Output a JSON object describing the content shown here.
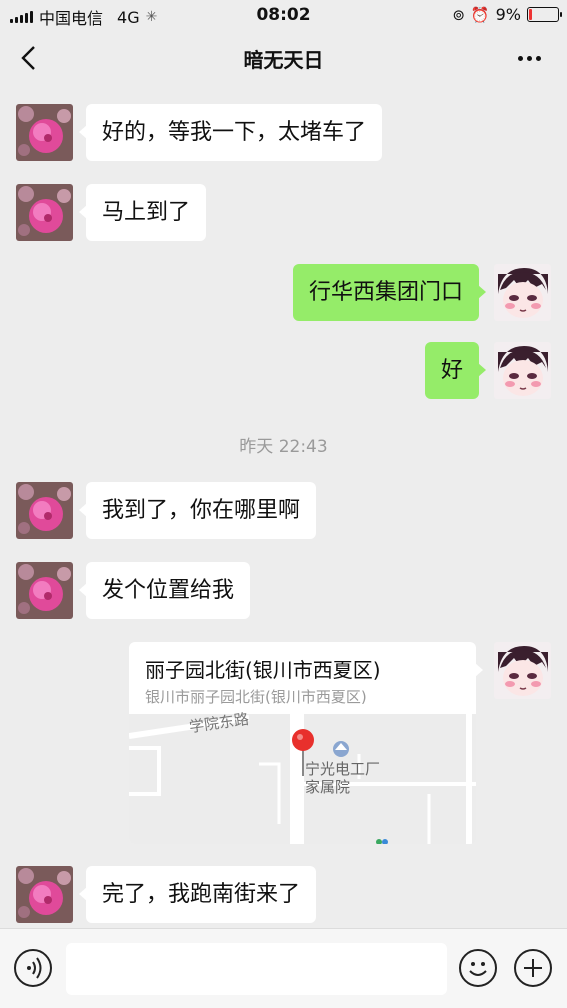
{
  "status_bar": {
    "carrier": "中国电信",
    "network": "4G",
    "time": "08:02",
    "battery_percent": "9%",
    "battery_level": 0.09
  },
  "header": {
    "title": "暗无天日"
  },
  "messages": [
    {
      "direction": "in",
      "text": "好的，等我一下，太堵车了"
    },
    {
      "direction": "in",
      "text": "马上到了"
    },
    {
      "direction": "out",
      "text": "行华西集团门口"
    },
    {
      "direction": "out",
      "text": "好"
    },
    {
      "direction": "in",
      "text": "我到了，你在哪里啊"
    },
    {
      "direction": "in",
      "text": "发个位置给我"
    },
    {
      "direction": "in",
      "text": "完了，我跑南街来了"
    }
  ],
  "timestamp": "昨天 22:43",
  "location": {
    "title": "丽子园北街(银川市西夏区)",
    "address": "银川市丽子园北街(银川市西夏区)",
    "map_label_road": "学院东路",
    "map_label_poi": "宁光电工厂\n家属院"
  },
  "input": {
    "placeholder": ""
  },
  "colors": {
    "outgoing_bubble": "#95ec69",
    "incoming_bubble": "#ffffff",
    "background": "#ededed",
    "pin": "#e8302c"
  }
}
